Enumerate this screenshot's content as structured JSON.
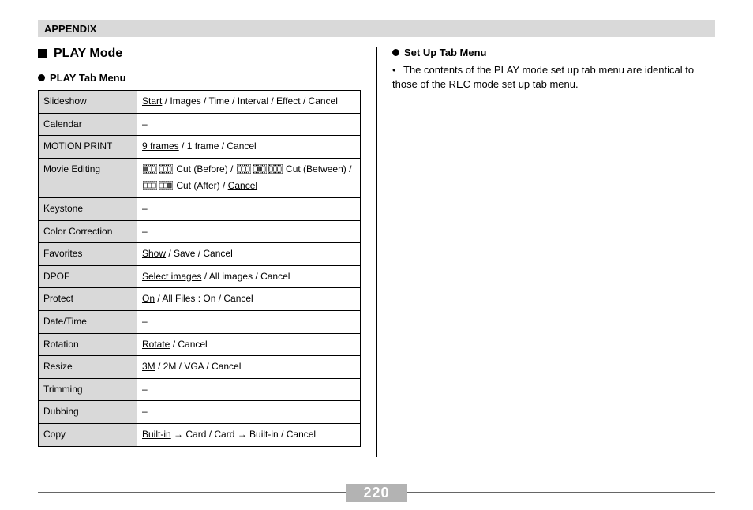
{
  "header": "APPENDIX",
  "section_title": "PLAY Mode",
  "play_tab_title": "PLAY Tab Menu",
  "setup_tab_title": "Set Up Tab Menu",
  "setup_text": "The contents of the PLAY mode set up tab menu are identical to those of the REC mode set up tab menu.",
  "page_number": "220",
  "table": {
    "rows": [
      {
        "label": "Slideshow",
        "parts": [
          {
            "t": "Start",
            "u": true
          },
          {
            "t": " / Images / Time / Interval / Effect / Cancel"
          }
        ]
      },
      {
        "label": "Calendar",
        "parts": [
          {
            "t": "–"
          }
        ]
      },
      {
        "label": "MOTION PRINT",
        "parts": [
          {
            "t": "9 frames",
            "u": true
          },
          {
            "t": " / 1 frame / Cancel"
          }
        ]
      },
      {
        "label": "Movie Editing",
        "movie": true,
        "segments": {
          "before_label": " Cut (Before) / ",
          "between_prefix": " Cut (Between) / ",
          "after_label": " Cut (After) / ",
          "cancel": "Cancel"
        }
      },
      {
        "label": "Keystone",
        "parts": [
          {
            "t": "–"
          }
        ]
      },
      {
        "label": "Color Correction",
        "parts": [
          {
            "t": "–"
          }
        ]
      },
      {
        "label": "Favorites",
        "parts": [
          {
            "t": "Show",
            "u": true
          },
          {
            "t": " / Save / Cancel"
          }
        ]
      },
      {
        "label": "DPOF",
        "parts": [
          {
            "t": "Select images",
            "u": true
          },
          {
            "t": " / All images / Cancel"
          }
        ]
      },
      {
        "label": "Protect",
        "parts": [
          {
            "t": "On",
            "u": true
          },
          {
            "t": " / All Files : On / Cancel"
          }
        ]
      },
      {
        "label": "Date/Time",
        "parts": [
          {
            "t": "–"
          }
        ]
      },
      {
        "label": "Rotation",
        "parts": [
          {
            "t": "Rotate",
            "u": true
          },
          {
            "t": " / Cancel"
          }
        ]
      },
      {
        "label": "Resize",
        "parts": [
          {
            "t": "3M",
            "u": true
          },
          {
            "t": " / 2M / VGA / Cancel"
          }
        ]
      },
      {
        "label": "Trimming",
        "parts": [
          {
            "t": "–"
          }
        ]
      },
      {
        "label": "Dubbing",
        "parts": [
          {
            "t": "–"
          }
        ]
      },
      {
        "label": "Copy",
        "parts": [
          {
            "t": "Built-in",
            "u": true
          },
          {
            "t": " → Card / Card → Built-in / Cancel"
          }
        ]
      }
    ]
  }
}
